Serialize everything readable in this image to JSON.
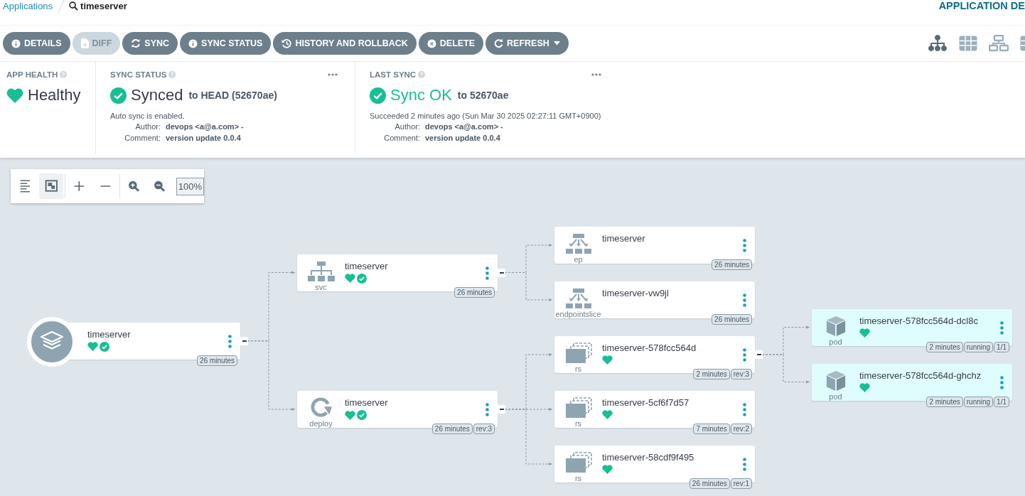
{
  "breadcrumb": {
    "link": "Applications",
    "current": "timeserver"
  },
  "header_right": "APPLICATION DE",
  "toolbar": [
    {
      "label": "DETAILS",
      "disabled": false
    },
    {
      "label": "DIFF",
      "disabled": true
    },
    {
      "label": "SYNC",
      "disabled": false
    },
    {
      "label": "SYNC STATUS",
      "disabled": false
    },
    {
      "label": "HISTORY AND ROLLBACK",
      "disabled": false
    },
    {
      "label": "DELETE",
      "disabled": false
    },
    {
      "label": "REFRESH",
      "disabled": false
    }
  ],
  "views": [
    {
      "kind": "tree",
      "selected": true
    },
    {
      "kind": "pods",
      "selected": false
    },
    {
      "kind": "network",
      "selected": false
    },
    {
      "kind": "list",
      "selected": false
    }
  ],
  "status_panels": [
    {
      "title": "APP HEALTH",
      "status": "Healthy",
      "kind": "health"
    },
    {
      "title": "SYNC STATUS",
      "status": "Synced",
      "kind": "sync",
      "target": "to HEAD (52670ae)",
      "note": "Auto sync is enabled.",
      "details": [
        {
          "label": "Author:",
          "value": "devops <a@a.com> -"
        },
        {
          "label": "Comment:",
          "value": "version update 0.0.4"
        }
      ]
    },
    {
      "title": "LAST SYNC",
      "status": "Sync OK",
      "kind": "operation",
      "target": "to 52670ae",
      "note": "Succeeded 2 minutes ago (Sun Mar 30 2025 02:27:11 GMT+0900)",
      "details": [
        {
          "label": "Author:",
          "value": "devops <a@a.com> -"
        },
        {
          "label": "Comment:",
          "value": "version update 0.0.4"
        }
      ]
    }
  ],
  "graph_tools": [
    {
      "kind": "list",
      "selected": false
    },
    {
      "kind": "fit",
      "selected": true
    },
    {
      "kind": "plus",
      "selected": false
    },
    {
      "kind": "minus",
      "selected": false
    },
    {
      "kind": "zoom-in",
      "selected": false
    },
    {
      "kind": "zoom-out",
      "selected": false
    }
  ],
  "zoom": "100%",
  "resource_tree": {
    "kind": "app",
    "name": "timeserver",
    "healthy": true,
    "synced": true,
    "badges": [
      "26 minutes"
    ],
    "children": [
      {
        "kind": "svc",
        "label": "svc",
        "name": "timeserver",
        "healthy": true,
        "synced": true,
        "badges": [
          "26 minutes"
        ],
        "children": [
          {
            "kind": "ep",
            "label": "ep",
            "name": "timeserver",
            "healthy": false,
            "synced": false,
            "badges": [
              "26 minutes"
            ]
          },
          {
            "kind": "ep",
            "label": "endpointslice",
            "name": "timeserver-vw9jl",
            "healthy": false,
            "synced": false,
            "badges": [
              "26 minutes"
            ]
          }
        ]
      },
      {
        "kind": "deploy",
        "label": "deploy",
        "name": "timeserver",
        "healthy": true,
        "synced": true,
        "badges": [
          "26 minutes",
          "rev:3"
        ],
        "children": [
          {
            "kind": "rs",
            "label": "rs",
            "name": "timeserver-578fcc564d",
            "healthy": true,
            "synced": false,
            "badges": [
              "2 minutes",
              "rev:3"
            ],
            "children": [
              {
                "kind": "pod",
                "label": "pod",
                "name": "timeserver-578fcc564d-dcl8c",
                "healthy": true,
                "synced": false,
                "badges": [
                  "2 minutes",
                  "running",
                  "1/1"
                ]
              },
              {
                "kind": "pod",
                "label": "pod",
                "name": "timeserver-578fcc564d-ghchz",
                "healthy": true,
                "synced": false,
                "badges": [
                  "2 minutes",
                  "running",
                  "1/1"
                ]
              }
            ]
          },
          {
            "kind": "rs",
            "label": "rs",
            "name": "timeserver-5cf6f7d57",
            "healthy": true,
            "synced": false,
            "badges": [
              "7 minutes",
              "rev:2"
            ]
          },
          {
            "kind": "rs",
            "label": "rs",
            "name": "timeserver-58cdf9f495",
            "healthy": true,
            "synced": false,
            "badges": [
              "26 minutes",
              "rev:1"
            ]
          }
        ]
      }
    ]
  }
}
